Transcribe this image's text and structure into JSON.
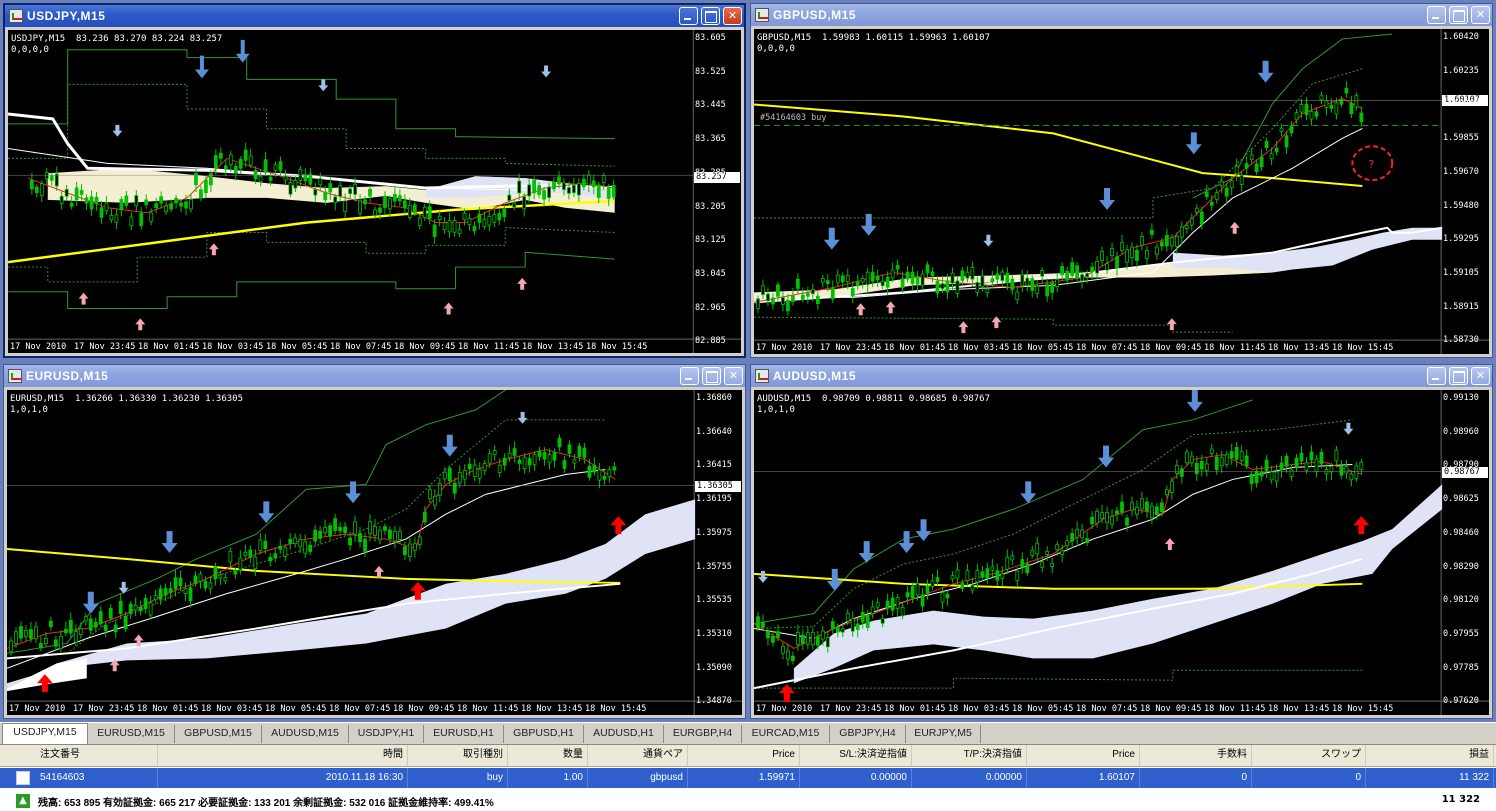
{
  "windows": [
    {
      "id": "usdjpy",
      "title": "USDJPY,M15",
      "info_line1": "USDJPY,M15  83.236 83.270 83.224 83.257",
      "info_line2": "0,0,0,0",
      "price_labels": [
        "83.605",
        "83.525",
        "83.445",
        "83.365",
        "83.285",
        "83.205",
        "83.125",
        "83.045",
        "82.965",
        "82.885"
      ],
      "current_price": "83.257",
      "time_labels": [
        "17 Nov 2010",
        "17 Nov 23:45",
        "18 Nov 01:45",
        "18 Nov 03:45",
        "18 Nov 05:45",
        "18 Nov 07:45",
        "18 Nov 09:45",
        "18 Nov 11:45",
        "18 Nov 13:45",
        "18 Nov 15:45"
      ]
    },
    {
      "id": "gbpusd",
      "title": "GBPUSD,M15",
      "info_line1": "GBPUSD,M15  1.59983 1.60115 1.59963 1.60107",
      "info_line2": "0,0,0,0",
      "order_label": "#54164603 buy",
      "price_labels": [
        "1.60420",
        "1.60235",
        "1.60045",
        "1.59855",
        "1.59670",
        "1.59480",
        "1.59295",
        "1.59105",
        "1.58915",
        "1.58730"
      ],
      "current_price": "1.60107",
      "time_labels": [
        "17 Nov 2010",
        "17 Nov 23:45",
        "18 Nov 01:45",
        "18 Nov 03:45",
        "18 Nov 05:45",
        "18 Nov 07:45",
        "18 Nov 09:45",
        "18 Nov 11:45",
        "18 Nov 13:45",
        "18 Nov 15:45"
      ]
    },
    {
      "id": "eurusd",
      "title": "EURUSD,M15",
      "info_line1": "EURUSD,M15  1.36266 1.36330 1.36230 1.36305",
      "info_line2": "1,0,1,0",
      "price_labels": [
        "1.36860",
        "1.36640",
        "1.36415",
        "1.36195",
        "1.35975",
        "1.35755",
        "1.35535",
        "1.35310",
        "1.35090",
        "1.34870"
      ],
      "current_price": "1.36305",
      "time_labels": [
        "17 Nov 2010",
        "17 Nov 23:45",
        "18 Nov 01:45",
        "18 Nov 03:45",
        "18 Nov 05:45",
        "18 Nov 07:45",
        "18 Nov 09:45",
        "18 Nov 11:45",
        "18 Nov 13:45",
        "18 Nov 15:45"
      ]
    },
    {
      "id": "audusd",
      "title": "AUDUSD,M15",
      "info_line1": "AUDUSD,M15  0.98709 0.98811 0.98685 0.98767",
      "info_line2": "1,0,1,0",
      "price_labels": [
        "0.99130",
        "0.98960",
        "0.98790",
        "0.98625",
        "0.98460",
        "0.98290",
        "0.98120",
        "0.97955",
        "0.97785",
        "0.97620"
      ],
      "current_price": "0.98767",
      "time_labels": [
        "17 Nov 2010",
        "17 Nov 23:45",
        "18 Nov 01:45",
        "18 Nov 03:45",
        "18 Nov 05:45",
        "18 Nov 07:45",
        "18 Nov 09:45",
        "18 Nov 11:45",
        "18 Nov 13:45",
        "18 Nov 15:45"
      ]
    }
  ],
  "tabs": [
    "USDJPY,M15",
    "EURUSD,M15",
    "GBPUSD,M15",
    "AUDUSD,M15",
    "USDJPY,H1",
    "EURUSD,H1",
    "GBPUSD,H1",
    "AUDUSD,H1",
    "EURGBP,H4",
    "EURCAD,M15",
    "GBPJPY,H4",
    "EURJPY,M5"
  ],
  "terminal": {
    "headers": [
      "注文番号",
      "時間",
      "取引種別",
      "数量",
      "通貨ペア",
      "Price",
      "S/L:決済逆指値",
      "T/P:決済指値",
      "Price",
      "手数料",
      "スワップ",
      "損益"
    ],
    "row": [
      "54164603",
      "2010.11.18 16:30",
      "buy",
      "1.00",
      "gbpusd",
      "1.59971",
      "0.00000",
      "0.00000",
      "1.60107",
      "0",
      "0",
      "11 322"
    ],
    "summary": "残高: 653 895  有効証拠金: 665 217  必要証拠金: 133 201  余剰証拠金: 532 016  証拠金維持率: 499.41%",
    "summary_profit": "11 322"
  },
  "colors": {
    "candle": "#00c000",
    "ma_red": "#ff2020",
    "ma_white": "#ffffff",
    "ma_yellow": "#ffff00",
    "band_green": "#2e9a2e",
    "cloud_light": "#f4efd2",
    "cloud_lavender": "#e0e2f6",
    "arrow_blue": "#5b8fd6",
    "arrow_pink": "#f4a6b2",
    "arrow_red": "#ff0000"
  }
}
